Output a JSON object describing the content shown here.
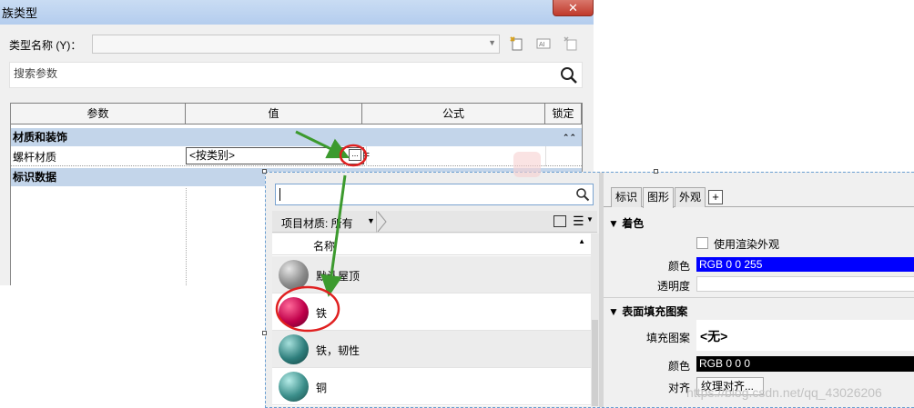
{
  "dialog": {
    "title": "族类型",
    "close_symbol": "✕",
    "type_name_label": "类型名称 (Y)：",
    "type_name_value": "",
    "search_placeholder": "搜索参数",
    "columns": [
      "参数",
      "值",
      "公式",
      "锁定"
    ],
    "groups": [
      {
        "label": "材质和装饰",
        "collapse_symbol": "≫"
      },
      {
        "label": "标识数据"
      }
    ],
    "param_row": {
      "name": "螺杆材质",
      "value": "<按类别>",
      "browse_label": "...",
      "eq": "="
    }
  },
  "material_browser": {
    "search_value": "",
    "library_label": "项目材质: 所有",
    "list_header": "名称",
    "materials": [
      {
        "name": "默认屋顶",
        "color": "#9a9a9a"
      },
      {
        "name": "铁",
        "color": "#c0004a"
      },
      {
        "name": "铁，韧性",
        "color": "#2e7e7c"
      },
      {
        "name": "铜",
        "color": "#3b8e8a"
      }
    ],
    "editor": {
      "tabs": [
        "标识",
        "图形",
        "外观"
      ],
      "active_tab": "图形",
      "add_tab_symbol": "+",
      "shading_section": "着色",
      "use_render_appearance": "使用渲染外观",
      "use_render_appearance_checked": false,
      "color_label": "颜色",
      "shading_color_value": "RGB 0 0 255",
      "shading_color_hex": "#0000ff",
      "transparency_label": "透明度",
      "surface_section": "表面填充图案",
      "fill_pattern_label": "填充图案",
      "fill_pattern_value": "<无>",
      "surface_color_label": "颜色",
      "surface_color_value": "RGB 0 0 0",
      "align_label": "对齐",
      "align_button": "纹理对齐..."
    }
  },
  "watermark": "https://blog.csdn.net/qq_43026206",
  "colors": {
    "annotation_arrow": "#3c9a2e",
    "annotation_circle": "#e02020",
    "title_bar": "#b4cdee",
    "group_row": "#c3d5ea"
  }
}
